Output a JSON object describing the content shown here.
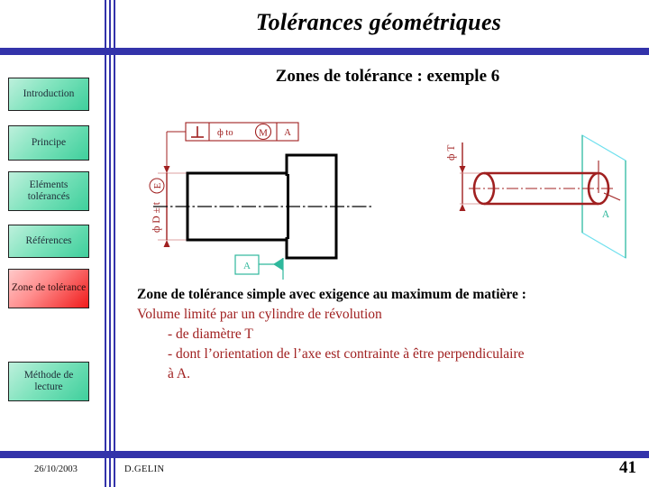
{
  "slide": {
    "title": "Tolérances géométriques",
    "subtitle": "Zones de tolérance : exemple 6"
  },
  "colors": {
    "rule": "#3333AA",
    "nav_green": "#5FD9B0",
    "nav_red": "#F01B1B",
    "drawing_red": "#A02020",
    "drawing_teal": "#2FB89C",
    "plane_cyan": "#6FE0EE",
    "body_red": "#A02020"
  },
  "sidebar": {
    "items": [
      {
        "label": "Introduction",
        "active": false
      },
      {
        "label": "Principe",
        "active": false
      },
      {
        "label": "Eléments tolérancés",
        "active": false
      },
      {
        "label": "Références",
        "active": false
      },
      {
        "label": "Zone de tolérance",
        "active": true
      },
      {
        "label": "Méthode de lecture",
        "active": false
      }
    ]
  },
  "left_drawing": {
    "feature_control_frame": {
      "symbol": "⊥",
      "tolerance": "ф to",
      "modifier": "M",
      "datum": "A"
    },
    "dimension_label": "ф D ± t",
    "envelope_modifier": "E",
    "datum_label": "A"
  },
  "right_drawing": {
    "zone_label": "ф T",
    "datum_plane_label": "A"
  },
  "body": {
    "heading_line1": "Zone de tolérance simple avec exigence au maximum de",
    "heading_line2": "matière :",
    "line3": "Volume limité par un cylindre de révolution",
    "bullet1": "- de diamètre T",
    "bullet2": "- dont l’orientation de l’axe est contrainte à être perpendiculaire",
    "bullet3": "à A."
  },
  "footer": {
    "date": "26/10/2003",
    "author": "D.GELIN",
    "page": "41"
  }
}
